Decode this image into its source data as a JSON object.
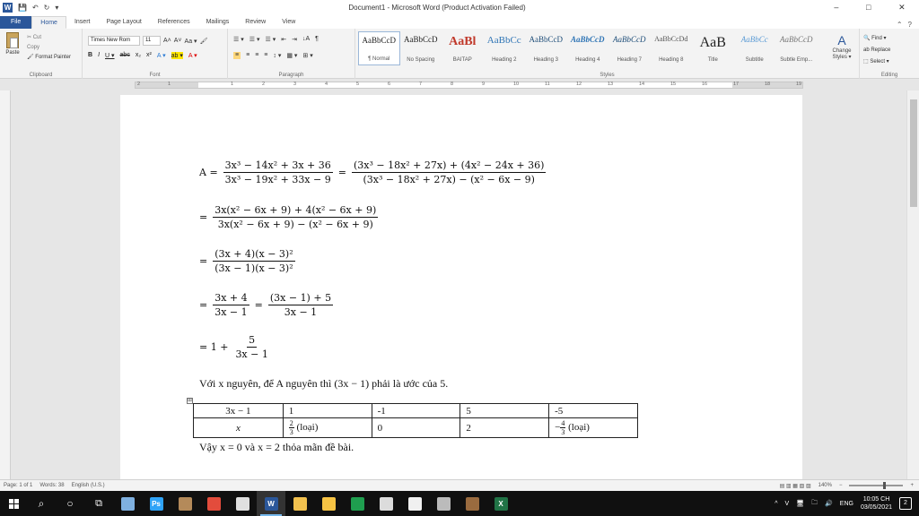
{
  "window": {
    "title": "Document1 - Microsoft Word (Product Activation Failed)",
    "controls": [
      "–",
      "□",
      "✕"
    ]
  },
  "qat": {
    "save_glyph": "💾",
    "undo_glyph": "↶",
    "redo_glyph": "↻",
    "more_glyph": "▾"
  },
  "tabs": [
    "File",
    "Home",
    "Insert",
    "Page Layout",
    "References",
    "Mailings",
    "Review",
    "View"
  ],
  "tab_help": "?",
  "clipboard": {
    "paste": "Paste",
    "cut": "✂ Cut",
    "copy": "Copy",
    "format_painter": "🖌 Format Painter",
    "label": "Clipboard"
  },
  "font": {
    "name": "Times New Rom",
    "size": "11",
    "label": "Font",
    "row1_buttons": [
      "A˄",
      "A˅",
      "Aa ▾",
      "🖌"
    ],
    "row2_buttons": [
      "B",
      "I",
      "U ▾",
      "abc",
      "x₂",
      "x²",
      "A ▾",
      "ab ▾",
      "A ▾"
    ]
  },
  "paragraph": {
    "label": "Paragraph",
    "row1": [
      "☰ ▾",
      "☰ ▾",
      "☰ ▾",
      "⇤",
      "⇥",
      "↓A",
      "¶"
    ],
    "row2": [
      "≡",
      "≡",
      "≡",
      "≡",
      "↕ ▾",
      "▦ ▾",
      "⊞ ▾"
    ]
  },
  "styles": {
    "label": "Styles",
    "items": [
      {
        "sample": "AaBbCcD",
        "name": "¶ Normal"
      },
      {
        "sample": "AaBbCcD",
        "name": "No Spacing"
      },
      {
        "sample": "AaBl",
        "name": "BAITAP"
      },
      {
        "sample": "AaBbCc",
        "name": "Heading 2"
      },
      {
        "sample": "AaBbCcD",
        "name": "Heading 3"
      },
      {
        "sample": "AaBbCcD",
        "name": "Heading 4"
      },
      {
        "sample": "AaBbCcD",
        "name": "Heading 7"
      },
      {
        "sample": "AaBbCcDd",
        "name": "Heading 8"
      },
      {
        "sample": "AaB",
        "name": "Title"
      },
      {
        "sample": "AaBbCc",
        "name": "Subtitle"
      },
      {
        "sample": "AaBbCcD",
        "name": "Subtle Emp..."
      }
    ],
    "change_icon": "A",
    "change_styles": "Change Styles ▾"
  },
  "editing": {
    "label": "Editing",
    "find": "🔍 Find ▾",
    "replace": "ab Replace",
    "select": "⬚ Select ▾"
  },
  "ruler": {
    "numbers": [
      "2",
      "1",
      "1",
      "2",
      "3",
      "4",
      "5",
      "6",
      "7",
      "8",
      "9",
      "10",
      "11",
      "12",
      "13",
      "14",
      "15",
      "16",
      "17",
      "18",
      "19"
    ],
    "tab_selector": "L"
  },
  "document": {
    "lines": [
      {
        "lhs": "A =",
        "fracs": [
          {
            "num": "3x³ − 14x² + 3x + 36",
            "den": "3x³ − 19x² + 33x − 9"
          },
          {
            "num": "(3x³ − 18x² + 27x) + (4x² − 24x + 36)",
            "den": "(3x³ − 18x² + 27x) − (x² − 6x − 9)"
          }
        ]
      },
      {
        "lhs": "=",
        "fracs": [
          {
            "num": "3x(x² − 6x + 9) + 4(x² − 6x + 9)",
            "den": "3x(x² − 6x + 9) − (x² − 6x + 9)"
          }
        ]
      },
      {
        "lhs": "=",
        "fracs": [
          {
            "num": "(3x + 4)(x − 3)²",
            "den": "(3x − 1)(x − 3)²"
          }
        ]
      },
      {
        "lhs": "=",
        "fracs": [
          {
            "num": "3x + 4",
            "den": "3x − 1"
          },
          {
            "num": "(3x − 1) + 5",
            "den": "3x − 1"
          }
        ]
      },
      {
        "lhs": "= 1 +",
        "fracs": [
          {
            "num": "5",
            "den": "3x − 1"
          }
        ]
      }
    ],
    "statement": "Với x nguyên, để A nguyên thì (3x − 1) phải là ước của 5.",
    "table": {
      "anchor": "⊞",
      "row1": [
        "3x − 1",
        "1",
        "-1",
        "5",
        "-5"
      ],
      "row2": {
        "label": "x",
        "c1": {
          "num": "2",
          "den": "3",
          "note": "(loại)"
        },
        "c2": "0",
        "c3": "2",
        "c4": {
          "sign": "−",
          "num": "4",
          "den": "3",
          "note": "(loại)"
        }
      }
    },
    "conclusion": "Vậy x = 0 và x = 2 thỏa mãn đề bài."
  },
  "status": {
    "page": "Page: 1 of 1",
    "words": "Words: 38",
    "language": "English (U.S.)",
    "zoom": "140%",
    "minus": "−",
    "plus": "+",
    "views": "▤ ▥ ▦ ▧ ▨"
  },
  "taskbar": {
    "search_glyph": "⌕",
    "cortana_glyph": "○",
    "taskview_glyph": "⧉",
    "apps": [
      {
        "name": "network-app",
        "color": "#7fb0e0"
      },
      {
        "name": "photoshop",
        "color": "#2fa3f7",
        "label": "Ps"
      },
      {
        "name": "archive-app",
        "color": "#b48a5a"
      },
      {
        "name": "chrome",
        "color": "#e34c3c"
      },
      {
        "name": "app-v",
        "color": "#e0e0e0"
      },
      {
        "name": "word",
        "color": "#2b579a",
        "label": "W",
        "active": true
      },
      {
        "name": "file-explorer",
        "color": "#f2c14e"
      },
      {
        "name": "emoji-app",
        "color": "#f6c344"
      },
      {
        "name": "maps-app",
        "color": "#1f9e4f"
      },
      {
        "name": "notepad",
        "color": "#dcdcdc"
      },
      {
        "name": "edit-app",
        "color": "#f0f0f0"
      },
      {
        "name": "printer-app",
        "color": "#bbbbbb"
      },
      {
        "name": "archive2-app",
        "color": "#9a6b3f"
      },
      {
        "name": "excel",
        "color": "#217346",
        "label": "X"
      }
    ],
    "tray": [
      "^",
      "V",
      "🖥",
      "🗀",
      "🔊",
      "ENG"
    ],
    "time": "10:05 CH",
    "date": "03/05/2021",
    "notifications": "2"
  }
}
